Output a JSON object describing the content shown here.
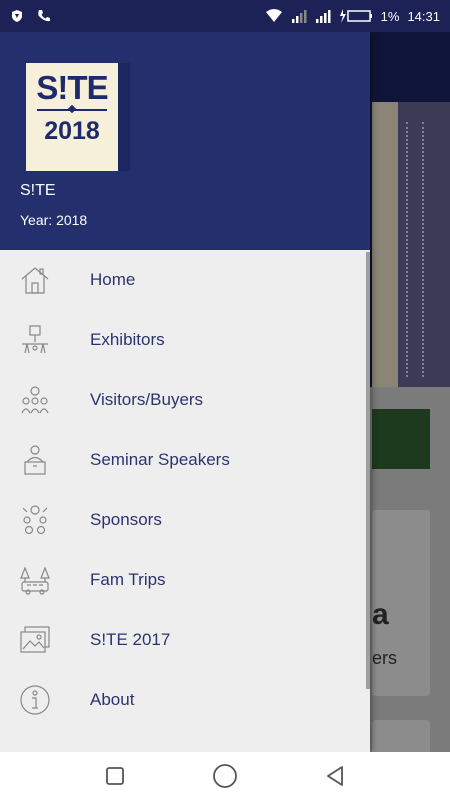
{
  "status_bar": {
    "battery": "1%",
    "time": "14:31"
  },
  "drawer": {
    "logo": {
      "title": "S!TE",
      "year": "2018"
    },
    "app_name": "S!TE",
    "app_year": "Year: 2018",
    "menu": [
      {
        "label": "Home",
        "icon": "home-icon"
      },
      {
        "label": "Exhibitors",
        "icon": "exhibitors-icon"
      },
      {
        "label": "Visitors/Buyers",
        "icon": "visitors-icon"
      },
      {
        "label": "Seminar Speakers",
        "icon": "speaker-icon"
      },
      {
        "label": "Sponsors",
        "icon": "sponsors-icon"
      },
      {
        "label": "Fam Trips",
        "icon": "fam-trips-icon"
      },
      {
        "label": "S!TE 2017",
        "icon": "gallery-icon"
      },
      {
        "label": "About",
        "icon": "info-icon"
      }
    ]
  },
  "background": {
    "card_text": "ers",
    "card_glyph": "a"
  },
  "colors": {
    "drawer_header": "#24306e",
    "menu_text": "#2c3470",
    "drawer_bg": "#eeeeee"
  }
}
